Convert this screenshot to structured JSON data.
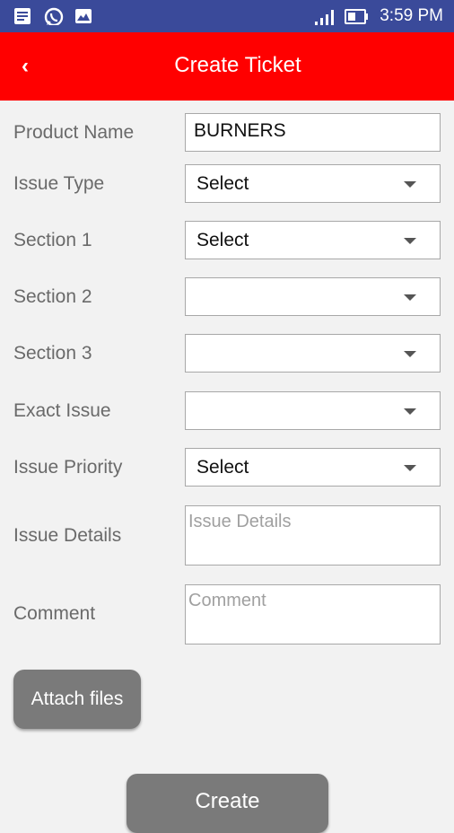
{
  "status_bar": {
    "time": "3:59 PM",
    "icons": [
      "notification-icon",
      "whatsapp-icon",
      "email-icon",
      "signal-icon",
      "battery-icon"
    ]
  },
  "header": {
    "title": "Create Ticket",
    "back_icon": "chevron-left-icon",
    "back_glyph": "‹"
  },
  "form": {
    "product_name": {
      "label": "Product Name",
      "value": "BURNERS"
    },
    "issue_type": {
      "label": "Issue Type",
      "value": "Select"
    },
    "section_1": {
      "label": "Section 1",
      "value": "Select"
    },
    "section_2": {
      "label": "Section 2",
      "value": ""
    },
    "section_3": {
      "label": "Section 3",
      "value": ""
    },
    "exact_issue": {
      "label": "Exact Issue",
      "value": ""
    },
    "issue_priority": {
      "label": "Issue Priority",
      "value": "Select"
    },
    "issue_details": {
      "label": "Issue Details",
      "placeholder": "Issue Details",
      "value": ""
    },
    "comment": {
      "label": "Comment",
      "placeholder": "Comment",
      "value": ""
    }
  },
  "buttons": {
    "attach": "Attach files",
    "create": "Create"
  },
  "colors": {
    "status_bar": "#3a4a9a",
    "app_bar": "#ff0000",
    "button": "#7a7a7a"
  }
}
